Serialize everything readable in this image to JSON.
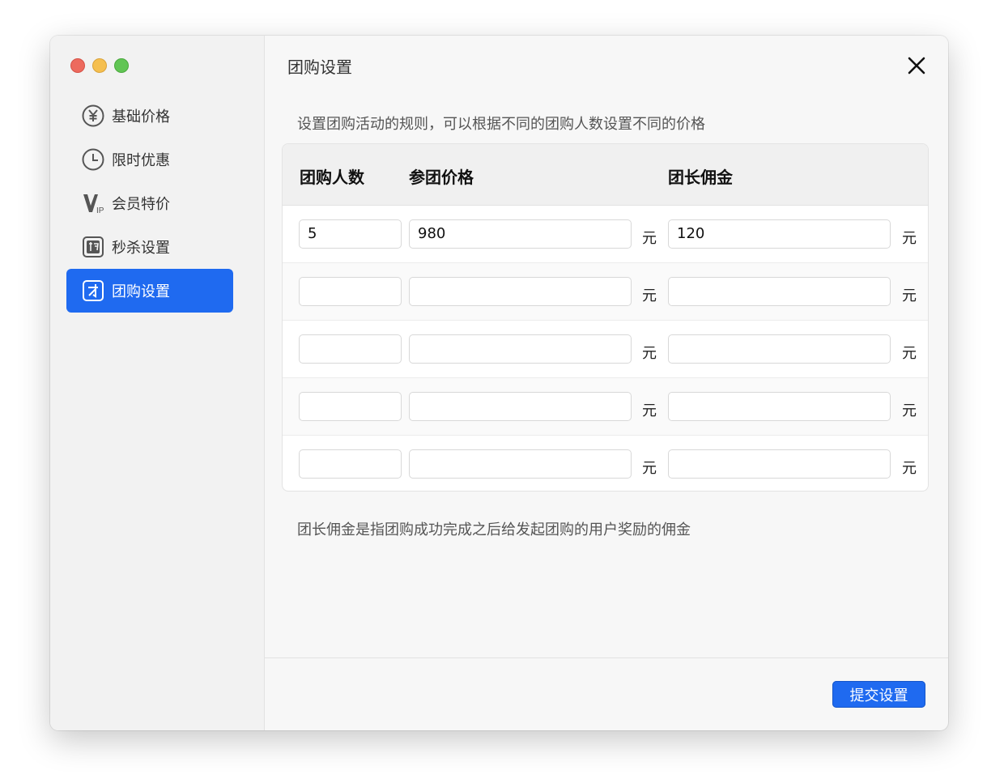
{
  "window": {
    "traffic_lights": [
      "red",
      "yellow",
      "green"
    ]
  },
  "sidebar": {
    "items": [
      {
        "label": "基础价格",
        "icon": "yen-circle-icon",
        "active": false
      },
      {
        "label": "限时优惠",
        "icon": "clock-icon",
        "active": false
      },
      {
        "label": "会员特价",
        "icon": "vip-icon",
        "active": false
      },
      {
        "label": "秒杀设置",
        "icon": "miao-badge-icon",
        "active": false
      },
      {
        "label": "团购设置",
        "icon": "tuan-badge-icon",
        "active": true
      }
    ]
  },
  "main": {
    "title": "团购设置",
    "description": "设置团购活动的规则，可以根据不同的团购人数设置不同的价格",
    "table": {
      "headers": [
        "团购人数",
        "参团价格",
        "团长佣金"
      ],
      "unit": "元",
      "rows": [
        {
          "count": "5",
          "price": "980",
          "commission": "120"
        },
        {
          "count": "",
          "price": "",
          "commission": ""
        },
        {
          "count": "",
          "price": "",
          "commission": ""
        },
        {
          "count": "",
          "price": "",
          "commission": ""
        },
        {
          "count": "",
          "price": "",
          "commission": ""
        }
      ]
    },
    "note": "团长佣金是指团购成功完成之后给发起团购的用户奖励的佣金",
    "submit_label": "提交设置"
  },
  "colors": {
    "accent": "#1f6af0",
    "traffic_red": "#ed6a5e",
    "traffic_yellow": "#f5bf4f",
    "traffic_green": "#61c554"
  }
}
